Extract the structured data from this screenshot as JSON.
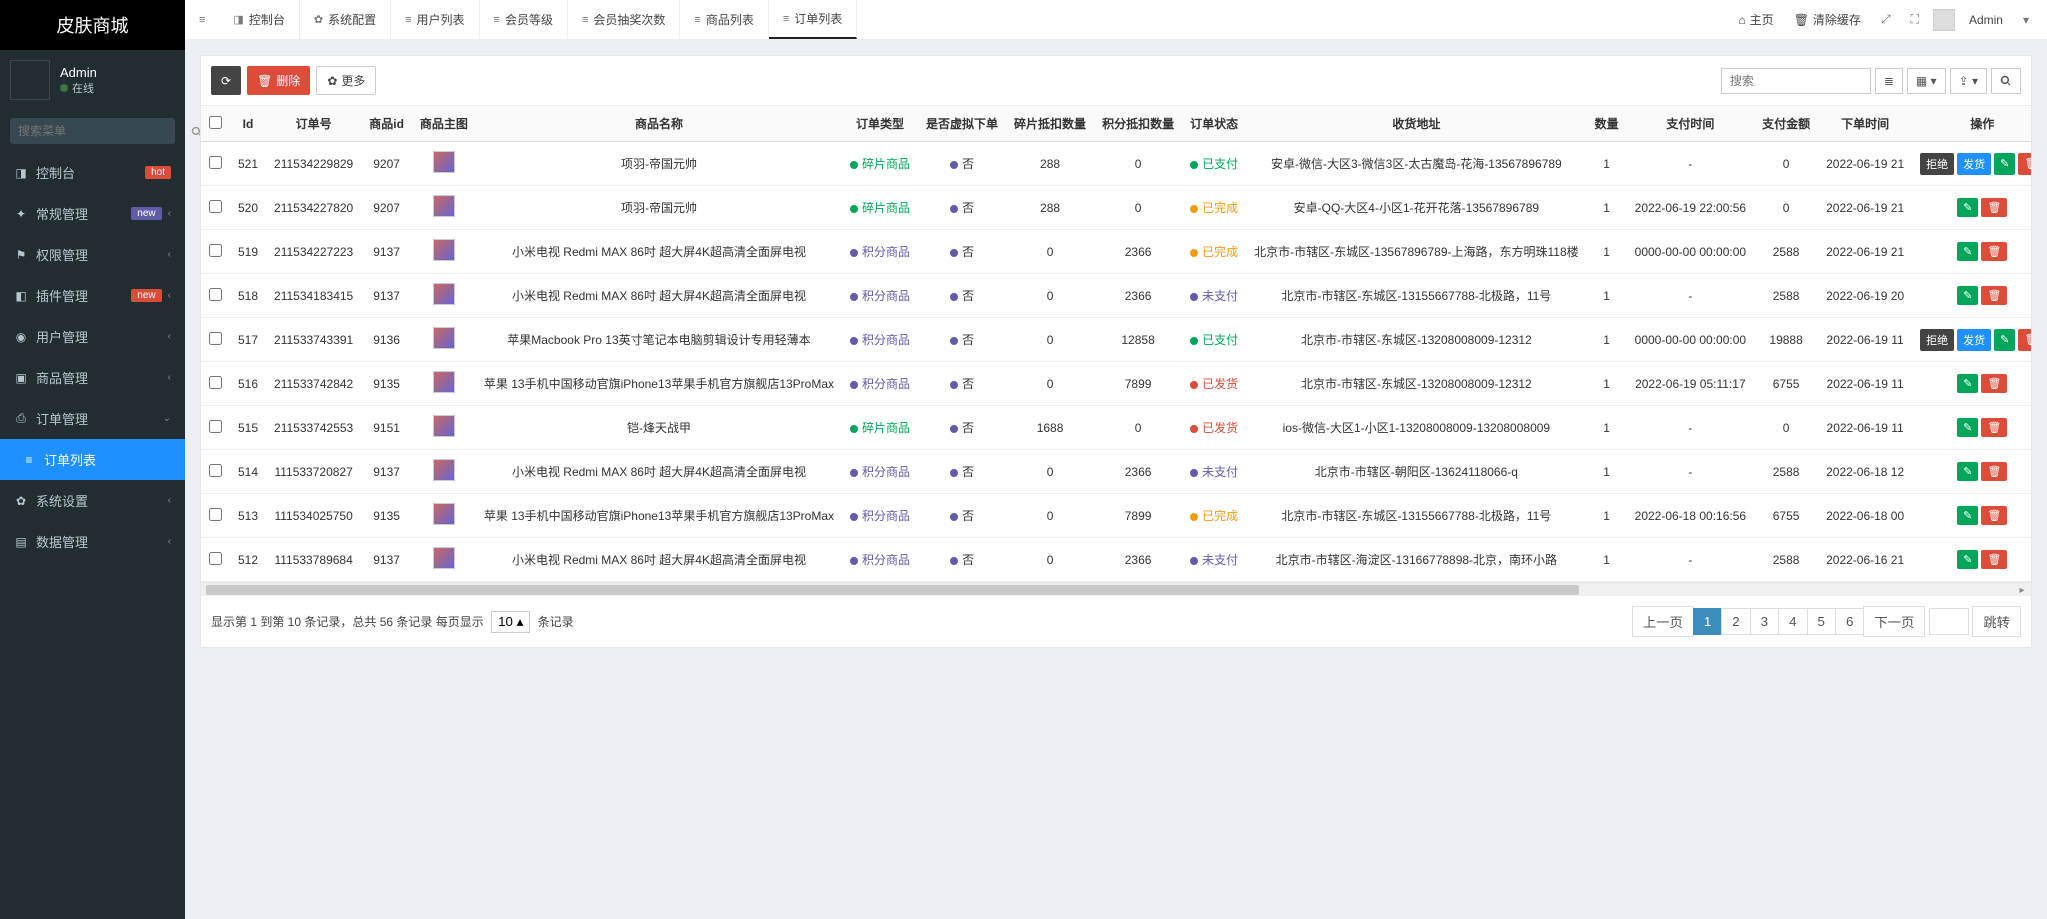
{
  "brand": "皮肤商城",
  "user": {
    "name": "Admin",
    "status": "在线"
  },
  "sidebar_search_placeholder": "搜索菜单",
  "sidebar": [
    {
      "icon": "◨",
      "label": "控制台",
      "badge": "hot",
      "badge_class": "badge-hot"
    },
    {
      "icon": "✦",
      "label": "常规管理",
      "badge": "new",
      "badge_class": "badge-new",
      "chevron": true
    },
    {
      "icon": "⚑",
      "label": "权限管理",
      "chevron": true
    },
    {
      "icon": "◧",
      "label": "插件管理",
      "badge": "new",
      "badge_class": "badge-new2",
      "chevron": true
    },
    {
      "icon": "◉",
      "label": "用户管理",
      "chevron": true
    },
    {
      "icon": "▣",
      "label": "商品管理",
      "chevron": true
    },
    {
      "icon": "⎙",
      "label": "订单管理",
      "chevron": true,
      "open": true,
      "children": [
        {
          "icon": "≡",
          "label": "订单列表",
          "active": true
        }
      ]
    },
    {
      "icon": "✿",
      "label": "系统设置",
      "chevron": true
    },
    {
      "icon": "▤",
      "label": "数据管理",
      "chevron": true
    }
  ],
  "tabs": [
    {
      "icon": "◨",
      "label": "控制台"
    },
    {
      "icon": "✿",
      "label": "系统配置"
    },
    {
      "icon": "≡",
      "label": "用户列表"
    },
    {
      "icon": "≡",
      "label": "会员等级"
    },
    {
      "icon": "≡",
      "label": "会员抽奖次数"
    },
    {
      "icon": "≡",
      "label": "商品列表"
    },
    {
      "icon": "≡",
      "label": "订单列表",
      "active": true
    }
  ],
  "top_right": {
    "home": "主页",
    "clear_cache": "清除缓存",
    "user": "Admin"
  },
  "toolbar": {
    "delete": "删除",
    "more": "更多",
    "search_placeholder": "搜索"
  },
  "columns": [
    "",
    "Id",
    "订单号",
    "商品id",
    "商品主图",
    "商品名称",
    "订单类型",
    "是否虚拟下单",
    "碎片抵扣数量",
    "积分抵扣数量",
    "订单状态",
    "收货地址",
    "数量",
    "支付时间",
    "支付金额",
    "下单时间",
    "操作"
  ],
  "order_type": {
    "frag": "碎片商品",
    "point": "积分商品"
  },
  "virtual_no": "否",
  "status": {
    "paid": "已支付",
    "done": "已完成",
    "unpaid": "未支付",
    "ship": "已发货"
  },
  "actions": {
    "reject": "拒绝",
    "ship": "发货"
  },
  "rows": [
    {
      "id": "521",
      "order": "211534229829",
      "gid": "9207",
      "name": "项羽-帝国元帅",
      "ot": "frag",
      "v": "否",
      "frag": "288",
      "pt": "0",
      "st": "paid",
      "addr": "安卓-微信-大区3-微信3区-太古魔岛-花海-13567896789",
      "qty": "1",
      "paytime": "-",
      "payamt": "0",
      "ordertime": "2022-06-19 21",
      "ops": [
        "reject",
        "ship",
        "edit",
        "del"
      ]
    },
    {
      "id": "520",
      "order": "211534227820",
      "gid": "9207",
      "name": "项羽-帝国元帅",
      "ot": "frag",
      "v": "否",
      "frag": "288",
      "pt": "0",
      "st": "done",
      "addr": "安卓-QQ-大区4-小区1-花开花落-13567896789",
      "qty": "1",
      "paytime": "2022-06-19 22:00:56",
      "payamt": "0",
      "ordertime": "2022-06-19 21",
      "ops": [
        "edit",
        "del"
      ]
    },
    {
      "id": "519",
      "order": "211534227223",
      "gid": "9137",
      "name": "小米电视 Redmi MAX 86吋 超大屏4K超高清全面屏电视",
      "ot": "point",
      "v": "否",
      "frag": "0",
      "pt": "2366",
      "st": "done",
      "addr": "北京市-市辖区-东城区-13567896789-上海路，东方明珠118楼",
      "qty": "1",
      "paytime": "0000-00-00 00:00:00",
      "payamt": "2588",
      "ordertime": "2022-06-19 21",
      "ops": [
        "edit",
        "del"
      ]
    },
    {
      "id": "518",
      "order": "211534183415",
      "gid": "9137",
      "name": "小米电视 Redmi MAX 86吋 超大屏4K超高清全面屏电视",
      "ot": "point",
      "v": "否",
      "frag": "0",
      "pt": "2366",
      "st": "unpaid",
      "addr": "北京市-市辖区-东城区-13155667788-北极路，11号",
      "qty": "1",
      "paytime": "-",
      "payamt": "2588",
      "ordertime": "2022-06-19 20",
      "ops": [
        "edit",
        "del"
      ]
    },
    {
      "id": "517",
      "order": "211533743391",
      "gid": "9136",
      "name": "苹果Macbook Pro 13英寸笔记本电脑剪辑设计专用轻薄本",
      "ot": "point",
      "v": "否",
      "frag": "0",
      "pt": "12858",
      "st": "paid",
      "addr": "北京市-市辖区-东城区-13208008009-12312",
      "qty": "1",
      "paytime": "0000-00-00 00:00:00",
      "payamt": "19888",
      "ordertime": "2022-06-19 11",
      "ops": [
        "reject",
        "ship",
        "edit",
        "del"
      ]
    },
    {
      "id": "516",
      "order": "211533742842",
      "gid": "9135",
      "name": "苹果 13手机中国移动官旗iPhone13苹果手机官方旗舰店13ProMax",
      "ot": "point",
      "v": "否",
      "frag": "0",
      "pt": "7899",
      "st": "ship",
      "addr": "北京市-市辖区-东城区-13208008009-12312",
      "qty": "1",
      "paytime": "2022-06-19 05:11:17",
      "payamt": "6755",
      "ordertime": "2022-06-19 11",
      "ops": [
        "edit",
        "del"
      ]
    },
    {
      "id": "515",
      "order": "211533742553",
      "gid": "9151",
      "name": "铠-烽天战甲",
      "ot": "frag",
      "v": "否",
      "frag": "1688",
      "pt": "0",
      "st": "ship",
      "addr": "ios-微信-大区1-小区1-13208008009-13208008009",
      "qty": "1",
      "paytime": "-",
      "payamt": "0",
      "ordertime": "2022-06-19 11",
      "ops": [
        "edit",
        "del"
      ]
    },
    {
      "id": "514",
      "order": "111533720827",
      "gid": "9137",
      "name": "小米电视 Redmi MAX 86吋 超大屏4K超高清全面屏电视",
      "ot": "point",
      "v": "否",
      "frag": "0",
      "pt": "2366",
      "st": "unpaid",
      "addr": "北京市-市辖区-朝阳区-13624118066-q",
      "qty": "1",
      "paytime": "-",
      "payamt": "2588",
      "ordertime": "2022-06-18 12",
      "ops": [
        "edit",
        "del"
      ]
    },
    {
      "id": "513",
      "order": "111534025750",
      "gid": "9135",
      "name": "苹果 13手机中国移动官旗iPhone13苹果手机官方旗舰店13ProMax",
      "ot": "point",
      "v": "否",
      "frag": "0",
      "pt": "7899",
      "st": "done",
      "addr": "北京市-市辖区-东城区-13155667788-北极路，11号",
      "qty": "1",
      "paytime": "2022-06-18 00:16:56",
      "payamt": "6755",
      "ordertime": "2022-06-18 00",
      "ops": [
        "edit",
        "del"
      ]
    },
    {
      "id": "512",
      "order": "111533789684",
      "gid": "9137",
      "name": "小米电视 Redmi MAX 86吋 超大屏4K超高清全面屏电视",
      "ot": "point",
      "v": "否",
      "frag": "0",
      "pt": "2366",
      "st": "unpaid",
      "addr": "北京市-市辖区-海淀区-13166778898-北京，南环小路",
      "qty": "1",
      "paytime": "-",
      "payamt": "2588",
      "ordertime": "2022-06-16 21",
      "ops": [
        "edit",
        "del"
      ]
    }
  ],
  "footer": {
    "info_prefix": "显示第 1 到第 10 条记录，总共 56 条记录 每页显示",
    "per_page": "10 ▴",
    "info_suffix": "条记录",
    "prev": "上一页",
    "next": "下一页",
    "jump": "跳转",
    "pages": [
      "1",
      "2",
      "3",
      "4",
      "5",
      "6"
    ]
  }
}
